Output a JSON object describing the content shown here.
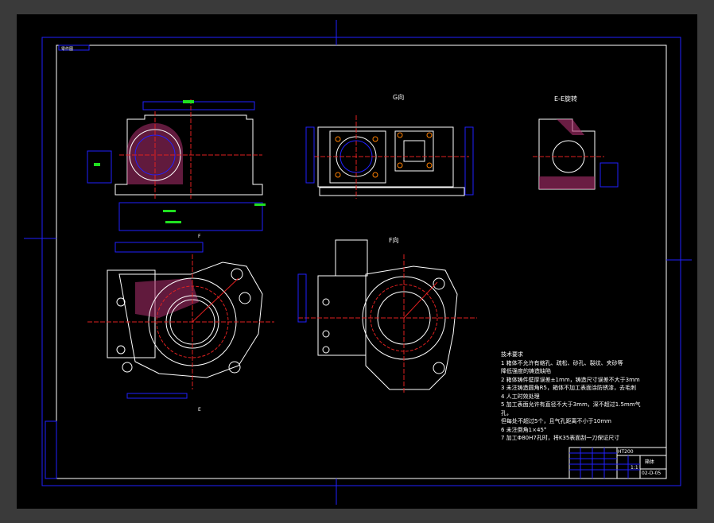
{
  "drawing": {
    "corner_tag": "零件图",
    "views": {
      "view_g": "G向",
      "view_ee": "E-E旋转",
      "view_f": "F向",
      "section_mark_f": "F",
      "section_mark_e": "E"
    },
    "tech_requirements": {
      "title": "技术要求",
      "items": [
        "1  箱体不允许有缩孔、疏松、砂孔、裂纹、夹砂等",
        "    降低强度的铸造缺陷",
        "2  箱体铸件壁厚误差±1mm，铸造尺寸误差不大于3mm",
        "3  未注铸造圆角R5，箱体不加工表面涂防锈漆，去毛刺",
        "4  人工时效处理",
        "5  加工表面允许有直径不大于3mm，深不超过1.5mm气",
        "孔，",
        "    但每处不超过5个，且气孔距离不小于10mm",
        "6  未注倒角1×45°",
        "7  加工Φ80H7孔时，将K35表面刮一刀保证尺寸"
      ]
    },
    "title_block": {
      "material": "HT200",
      "part_name": "箱体",
      "scale": "1:1",
      "drawing_no": "02-D-05"
    }
  }
}
